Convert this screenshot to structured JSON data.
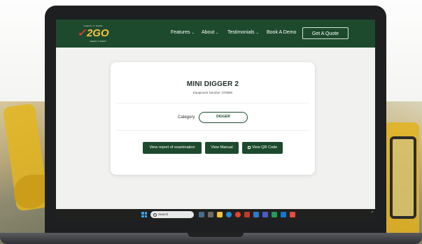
{
  "nav": {
    "items": [
      {
        "label": "Features",
        "has_menu": true
      },
      {
        "label": "About",
        "has_menu": true
      },
      {
        "label": "Testimonials",
        "has_menu": true
      },
      {
        "label": "Book A Demo",
        "has_menu": false
      }
    ],
    "cta_label": "Get A Quote",
    "logo": {
      "tagline": "CHECK IT ONCE",
      "text": "2GO",
      "subline": "CHECK IT RIGHT"
    }
  },
  "equipment": {
    "title": "MINI DIGGER 2",
    "number_text": "Equipment Number: 878980",
    "category_label": "Category",
    "category_value": "DIGGER"
  },
  "actions": {
    "report": "View report of examination",
    "manual": "View Manual",
    "qr": "View QR Code"
  },
  "taskbar": {
    "search_placeholder": "Search",
    "apps": [
      "file-explorer-icon",
      "edge-icon",
      "chrome-icon",
      "store-icon",
      "teams-icon",
      "word-icon",
      "excel-icon",
      "outlook-icon",
      "acrobat-icon",
      "settings-icon"
    ]
  },
  "colors": {
    "brand_green": "#1d4a2d",
    "page_bg": "#f1f2ef",
    "card_bg": "#ffffff"
  }
}
